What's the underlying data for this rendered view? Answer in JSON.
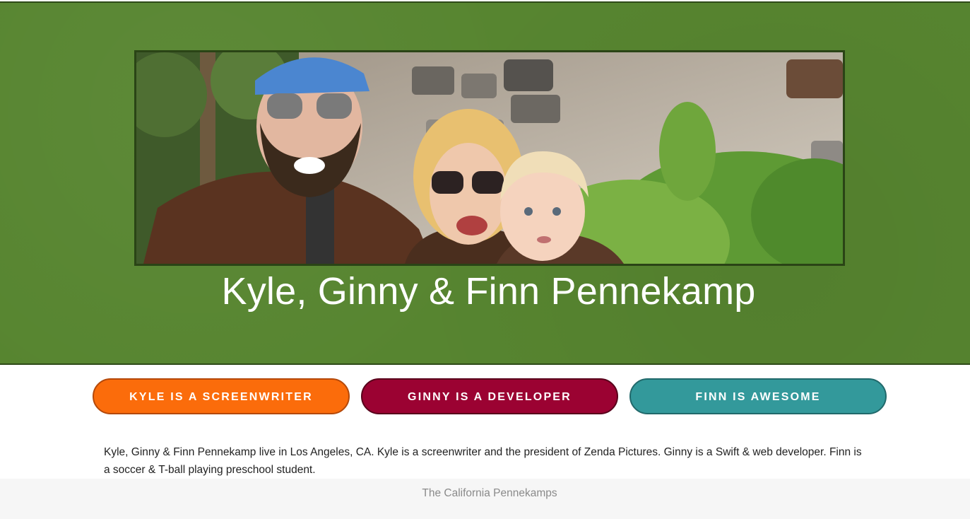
{
  "hero": {
    "photo_alt": "Family photo of Kyle, Ginny and Finn outdoors",
    "title": "Kyle, Ginny & Finn Pennekamp"
  },
  "buttons": {
    "kyle": "KYLE IS A SCREENWRITER",
    "ginny": "GINNY IS A DEVELOPER",
    "finn": "FINN IS AWESOME"
  },
  "bio": "Kyle, Ginny & Finn Pennekamp live in Los Angeles, CA. Kyle is a screenwriter and the president of Zenda Pictures. Ginny is a Swift & web developer. Finn is a soccer & T-ball playing preschool student.",
  "footer": {
    "text": "The California Pennekamps"
  },
  "colors": {
    "hero_green": "#578530",
    "kyle_orange": "#fb6c0b",
    "ginny_crimson": "#9b0232",
    "finn_teal": "#33999b",
    "footer_bg": "#f6f6f6"
  }
}
